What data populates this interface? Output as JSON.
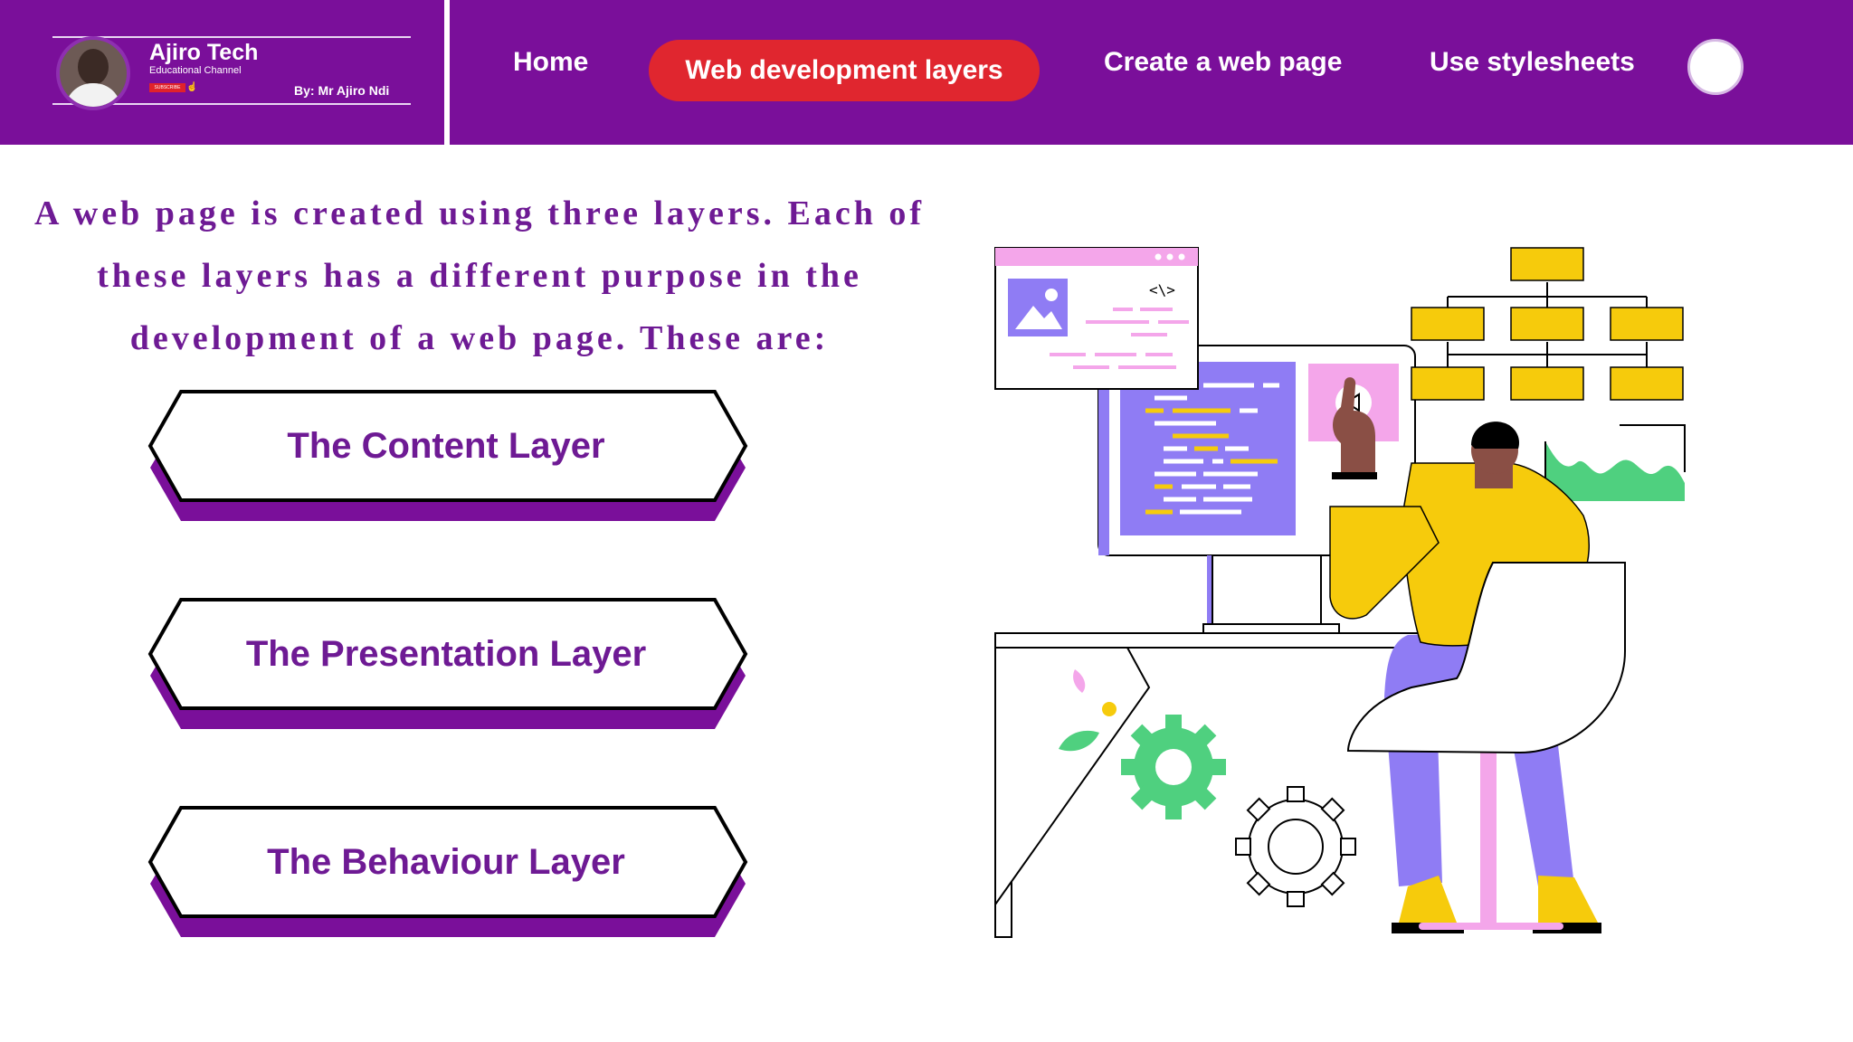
{
  "brand": {
    "name": "Ajiro Tech",
    "subtitle": "Educational Channel",
    "subscribe_label": "SUBSCRIBE",
    "byline": "By: Mr Ajiro Ndi"
  },
  "nav": {
    "home": "Home",
    "active": "Web development layers",
    "create": "Create a web page",
    "stylesheets": "Use stylesheets"
  },
  "intro": "A web page is created using three layers. Each of these layers has a different purpose in the development of a web page. These are:",
  "layers": [
    {
      "label": "The Content Layer"
    },
    {
      "label": "The Presentation Layer"
    },
    {
      "label": "The Behaviour Layer"
    }
  ],
  "illustration": {
    "code_tag": "<\\>"
  },
  "colors": {
    "brand_purple": "#7a0f9a",
    "active_red": "#e0262f",
    "text_purple": "#6e1a94",
    "accent_yellow": "#f6cb0c",
    "accent_green": "#4fd07f",
    "accent_lavender": "#8f7cf4",
    "accent_pink": "#f4a6ea"
  }
}
